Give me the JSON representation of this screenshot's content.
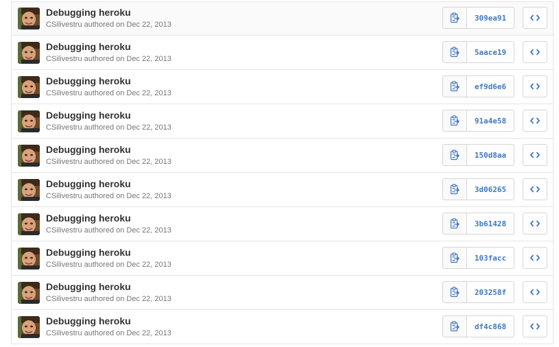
{
  "colors": {
    "sha_link": "#4078c0",
    "title": "#333333",
    "meta": "#767676",
    "border": "#e5e5e5"
  },
  "icons": {
    "copy": "clippy-icon",
    "browse": "code-icon"
  },
  "commits": [
    {
      "title": "Debugging heroku",
      "author": "CSilivestru",
      "date_text": "authored on Dec 22, 2013",
      "sha": "309ea91"
    },
    {
      "title": "Debugging heroku",
      "author": "CSilivestru",
      "date_text": "authored on Dec 22, 2013",
      "sha": "5aace19"
    },
    {
      "title": "Debugging heroku",
      "author": "CSilivestru",
      "date_text": "authored on Dec 22, 2013",
      "sha": "ef9d6e6"
    },
    {
      "title": "Debugging heroku",
      "author": "CSilivestru",
      "date_text": "authored on Dec 22, 2013",
      "sha": "91a4e58"
    },
    {
      "title": "Debugging heroku",
      "author": "CSilivestru",
      "date_text": "authored on Dec 22, 2013",
      "sha": "150d8aa"
    },
    {
      "title": "Debugging heroku",
      "author": "CSilivestru",
      "date_text": "authored on Dec 22, 2013",
      "sha": "3d06265"
    },
    {
      "title": "Debugging heroku",
      "author": "CSilivestru",
      "date_text": "authored on Dec 22, 2013",
      "sha": "3b61428"
    },
    {
      "title": "Debugging heroku",
      "author": "CSilivestru",
      "date_text": "authored on Dec 22, 2013",
      "sha": "103facc"
    },
    {
      "title": "Debugging heroku",
      "author": "CSilivestru",
      "date_text": "authored on Dec 22, 2013",
      "sha": "203258f"
    },
    {
      "title": "Debugging heroku",
      "author": "CSilivestru",
      "date_text": "authored on Dec 22, 2013",
      "sha": "df4c868"
    }
  ]
}
